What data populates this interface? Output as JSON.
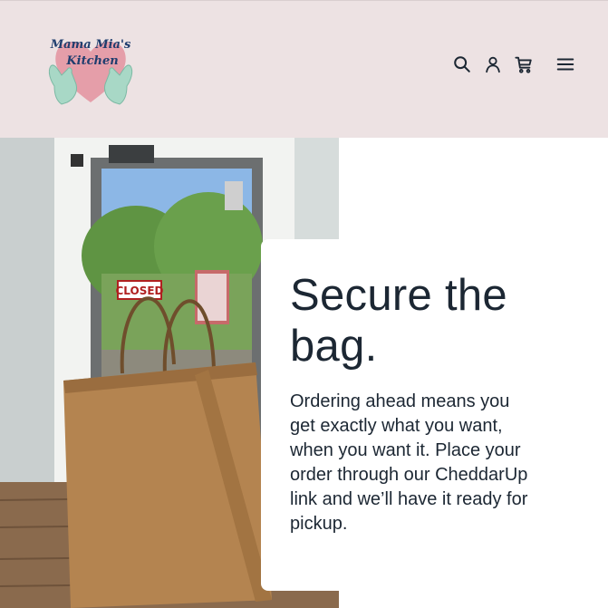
{
  "header": {
    "logo": {
      "text_line1": "Mama Mia's",
      "text_line2": "Kitchen",
      "icon": "heart-hands-logo"
    },
    "icons": [
      "search-icon",
      "account-icon",
      "cart-icon",
      "menu-icon"
    ]
  },
  "hero": {
    "image_sign_text": "CLOSED",
    "headline": "Secure the bag.",
    "body": "Ordering ahead means you get exactly what you want, when you want it. Place your order through our CheddarUp link and we’ll have it ready for pickup."
  },
  "colors": {
    "header_bg": "#ede2e3",
    "heading": "#1c2733",
    "logo_heart": "#e59ea9",
    "logo_hands": "#a8d8c6"
  }
}
